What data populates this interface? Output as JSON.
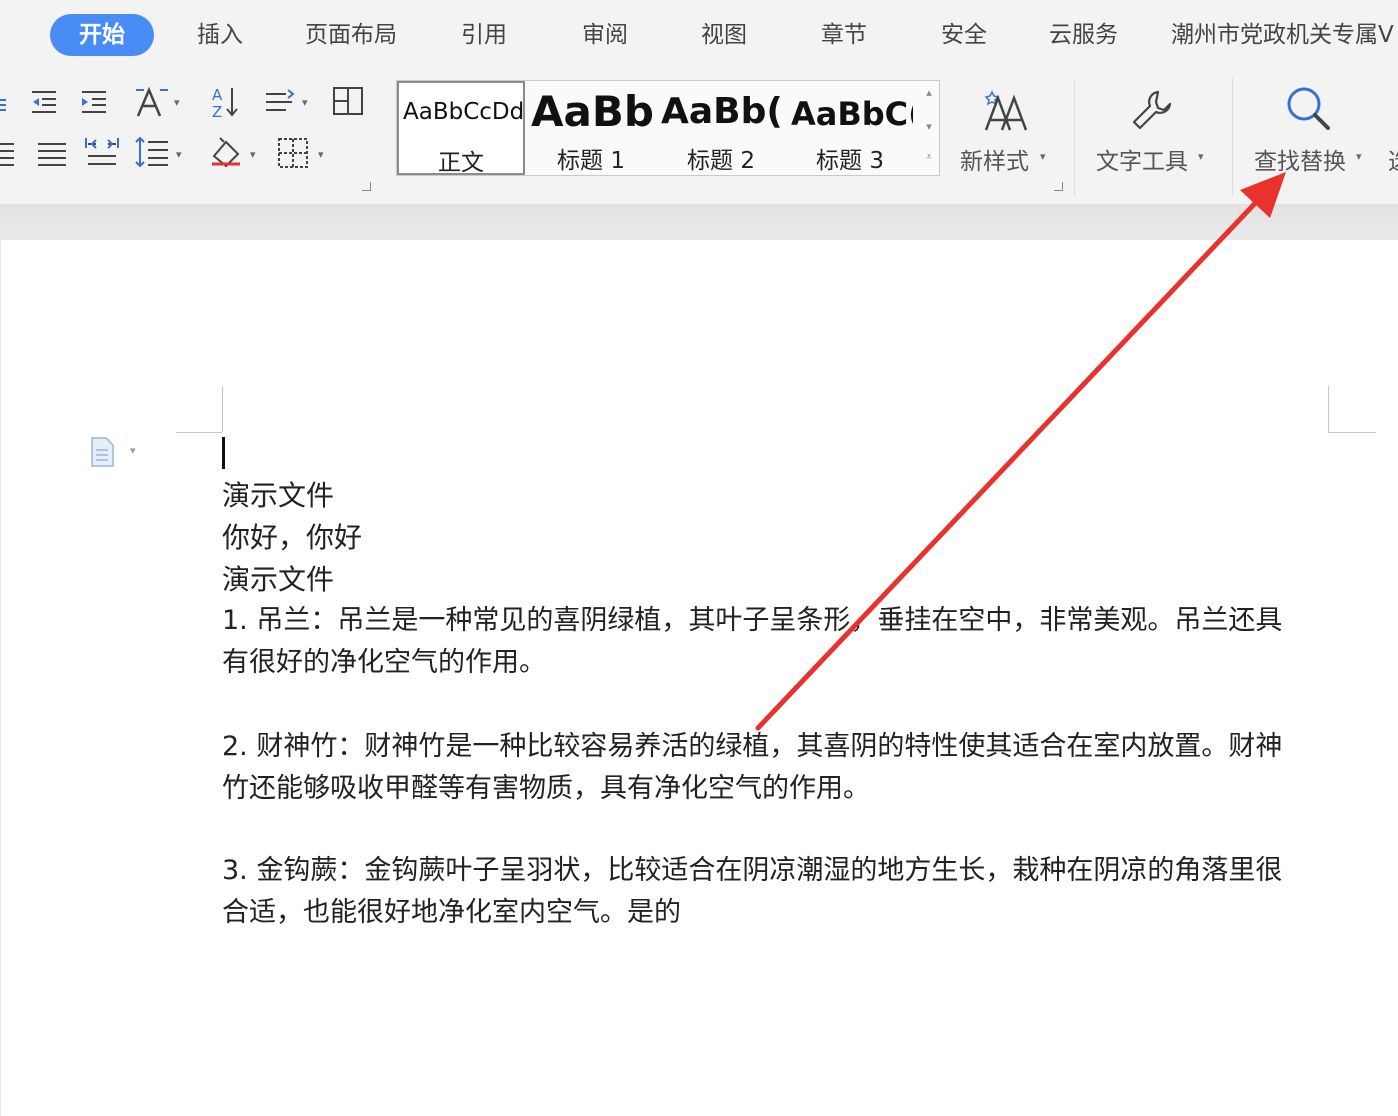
{
  "tabs": [
    {
      "label": "开始",
      "active": true
    },
    {
      "label": "插入"
    },
    {
      "label": "页面布局"
    },
    {
      "label": "引用"
    },
    {
      "label": "审阅"
    },
    {
      "label": "视图"
    },
    {
      "label": "章节"
    },
    {
      "label": "安全"
    },
    {
      "label": "云服务"
    },
    {
      "label": "潮州市党政机关专属V"
    }
  ],
  "ribbon": {
    "styles": [
      {
        "sample": "AaBbCcDd",
        "name": "正文",
        "selected": true
      },
      {
        "sample": "AaBb",
        "name": "标题 1"
      },
      {
        "sample": "AaBb(",
        "name": "标题 2"
      },
      {
        "sample": "AaBbC(",
        "name": "标题 3"
      }
    ],
    "new_style": "新样式",
    "text_tools": "文字工具",
    "find_replace": "查找替换",
    "cut_off_label": "选"
  },
  "document": {
    "lines": [
      "演示文件",
      "你好，你好",
      "演示文件",
      "1. 吊兰：吊兰是一种常见的喜阴绿植，其叶子呈条形，垂挂在空中，非常美观。吊兰还具",
      "有很好的净化空气的作用。",
      "2. 财神竹：财神竹是一种比较容易养活的绿植，其喜阴的特性使其适合在室内放置。财神",
      "竹还能够吸收甲醛等有害物质，具有净化空气的作用。",
      "3. 金钩蕨：金钩蕨叶子呈羽状，比较适合在阴凉潮湿的地方生长，栽种在阴凉的角落里很",
      "合适，也能很好地净化室内空气。是的"
    ]
  },
  "annotation": {
    "arrow_color": "#e8322d",
    "target": "查找替换"
  },
  "colors": {
    "accent": "#4a8cf5",
    "ribbon_bg": "#f3f3f3"
  }
}
